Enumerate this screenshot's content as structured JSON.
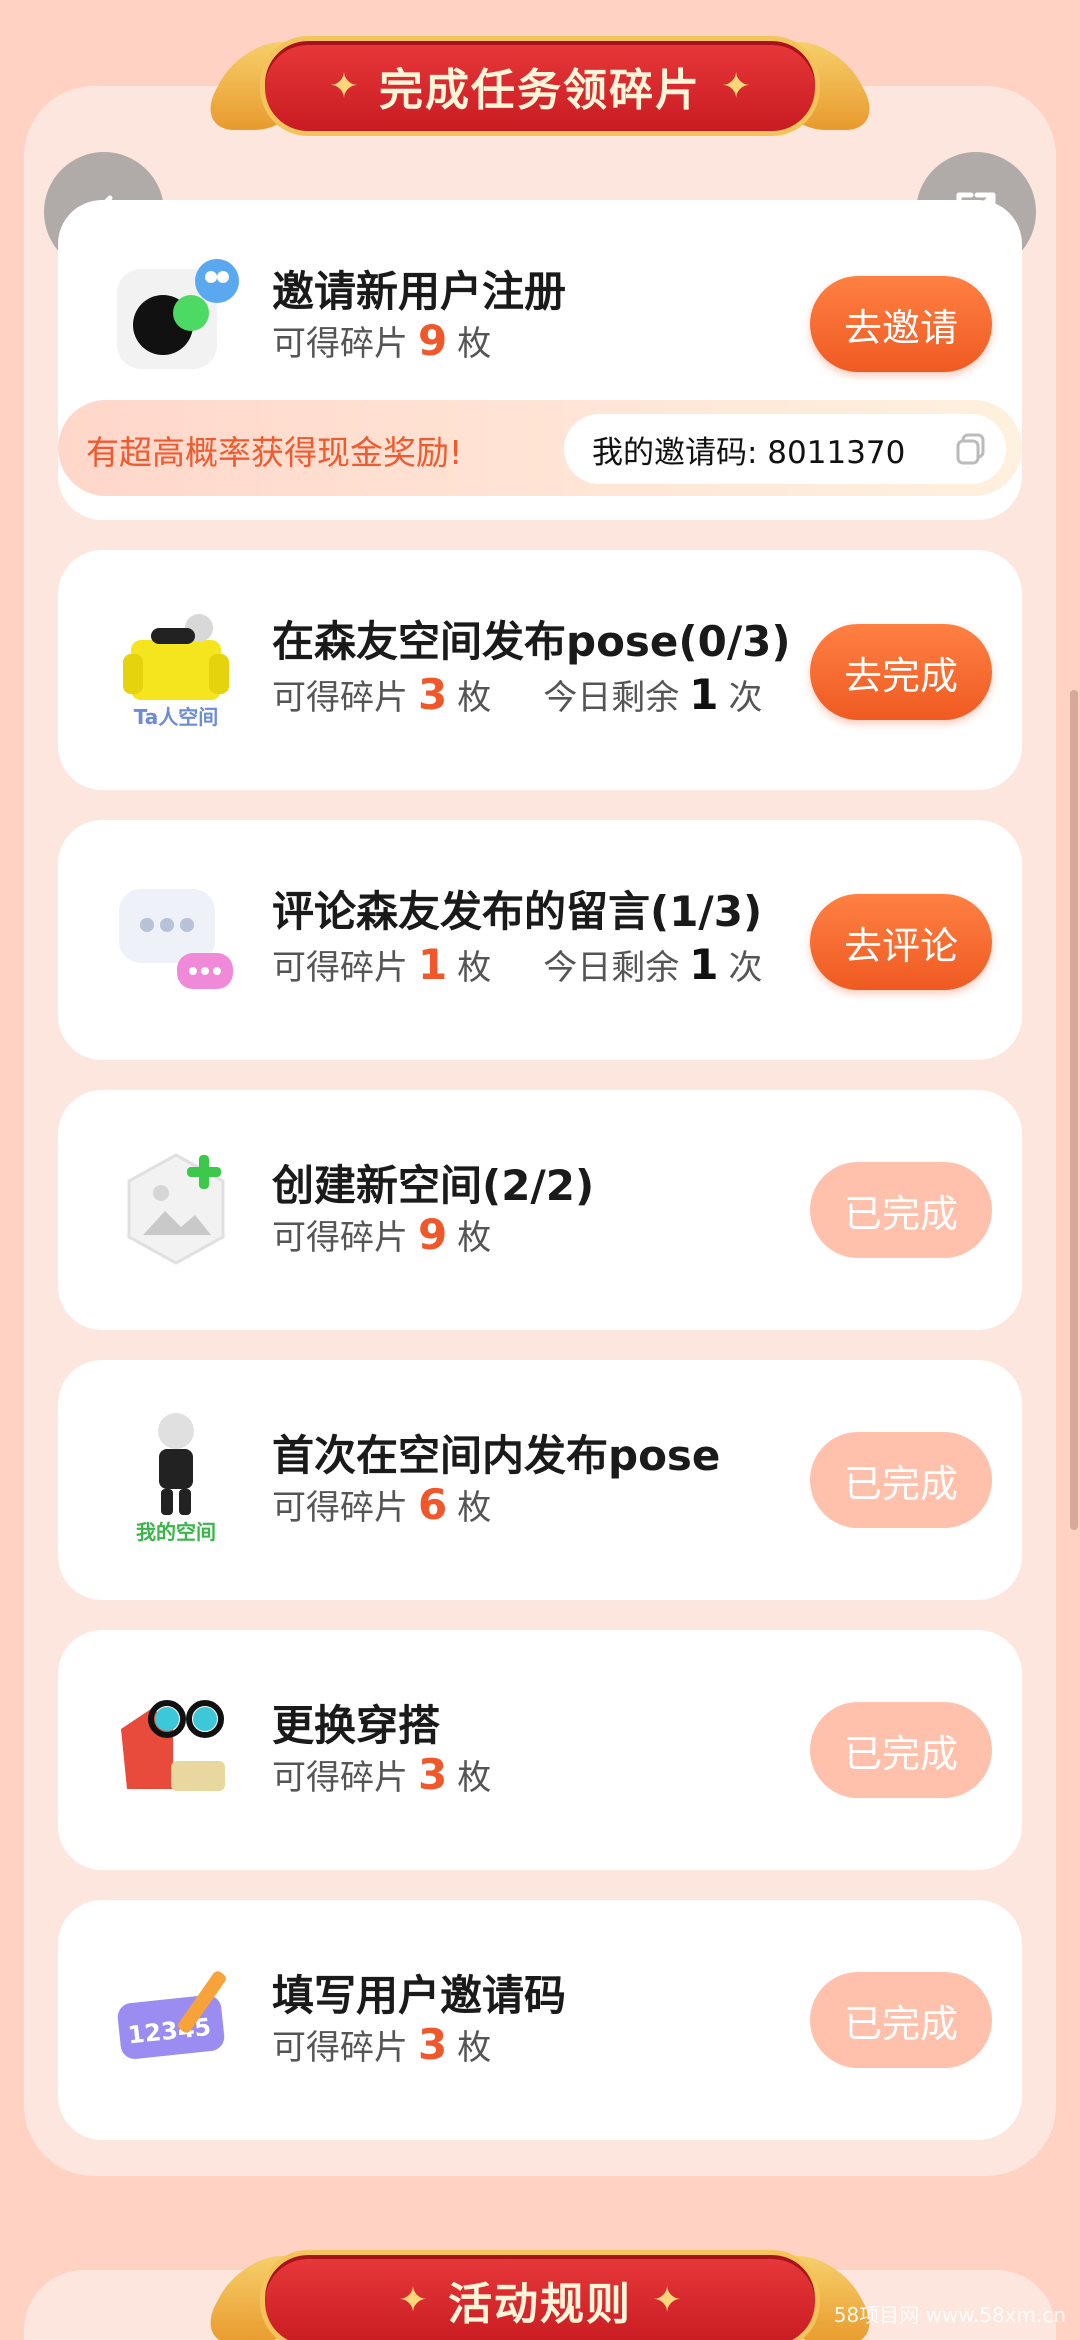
{
  "header": {
    "title": "完成任务领碎片",
    "star": "✦"
  },
  "nav": {
    "back_icon": "chevron-left-icon",
    "share_icon": "share-icon"
  },
  "tasks": [
    {
      "title": "邀请新用户注册",
      "reward_prefix": "可得碎片",
      "reward": "9",
      "reward_unit": "枚",
      "button": "去邀请",
      "state": "active",
      "hint": "有超高概率获得现金奖励!",
      "invite_code": "我的邀请码: 8011370"
    },
    {
      "title": "在森友空间发布pose(0/3)",
      "reward_prefix": "可得碎片",
      "reward": "3",
      "reward_unit": "枚",
      "remain_prefix": "今日剩余",
      "remain": "1",
      "remain_unit": "次",
      "button": "去完成",
      "state": "active",
      "icon_label": "Ta人空间"
    },
    {
      "title": "评论森友发布的留言(1/3)",
      "reward_prefix": "可得碎片",
      "reward": "1",
      "reward_unit": "枚",
      "remain_prefix": "今日剩余",
      "remain": "1",
      "remain_unit": "次",
      "button": "去评论",
      "state": "active"
    },
    {
      "title": "创建新空间(2/2)",
      "reward_prefix": "可得碎片",
      "reward": "9",
      "reward_unit": "枚",
      "button": "已完成",
      "state": "done"
    },
    {
      "title": "首次在空间内发布pose",
      "reward_prefix": "可得碎片",
      "reward": "6",
      "reward_unit": "枚",
      "button": "已完成",
      "state": "done",
      "icon_label": "我的空间"
    },
    {
      "title": "更换穿搭",
      "reward_prefix": "可得碎片",
      "reward": "3",
      "reward_unit": "枚",
      "button": "已完成",
      "state": "done"
    },
    {
      "title": "填写用户邀请码",
      "reward_prefix": "可得碎片",
      "reward": "3",
      "reward_unit": "枚",
      "button": "已完成",
      "state": "done",
      "icon_label": "12345"
    }
  ],
  "rules_banner": {
    "title": "活动规则"
  },
  "watermark": "58项目网 www.58xm.cn",
  "colors": {
    "accent": "#f0582c",
    "done": "#ffc0ac",
    "banner": "#d42a2e"
  }
}
